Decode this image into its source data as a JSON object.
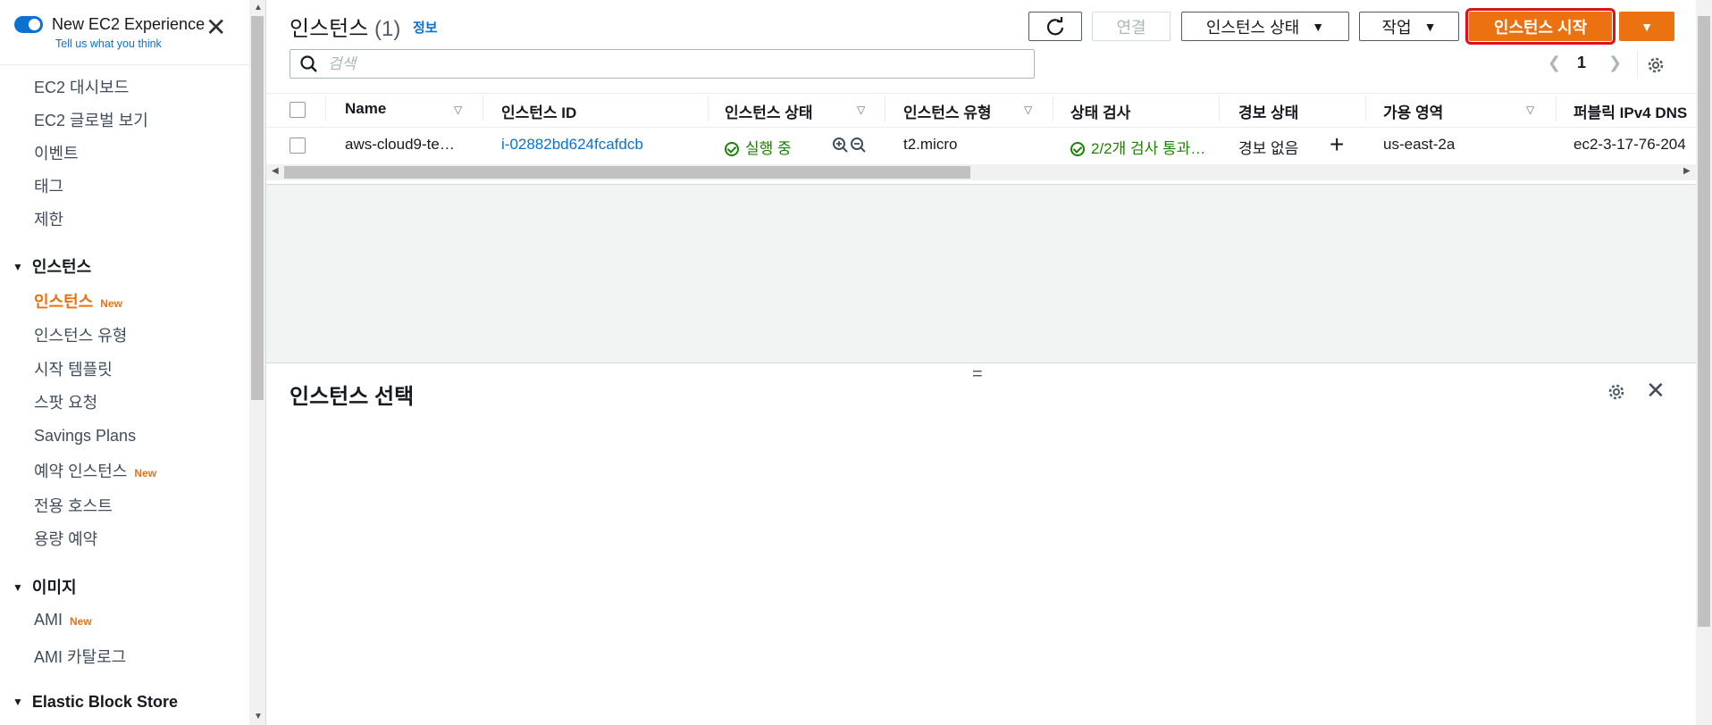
{
  "experience": {
    "title": "New EC2 Experience",
    "subtitle": "Tell us what you think"
  },
  "sidebar": {
    "top_items": [
      {
        "label": "EC2 대시보드"
      },
      {
        "label": "EC2 글로벌 보기"
      },
      {
        "label": "이벤트"
      },
      {
        "label": "태그"
      },
      {
        "label": "제한"
      }
    ],
    "sections": [
      {
        "title": "인스턴스",
        "items": [
          {
            "label": "인스턴스",
            "badge": "New",
            "active": true
          },
          {
            "label": "인스턴스 유형"
          },
          {
            "label": "시작 템플릿"
          },
          {
            "label": "스팟 요청"
          },
          {
            "label": "Savings Plans"
          },
          {
            "label": "예약 인스턴스",
            "badge": "New"
          },
          {
            "label": "전용 호스트"
          },
          {
            "label": "용량 예약"
          }
        ]
      },
      {
        "title": "이미지",
        "items": [
          {
            "label": "AMI",
            "badge": "New"
          },
          {
            "label": "AMI 카탈로그"
          }
        ]
      },
      {
        "title": "Elastic Block Store",
        "items": []
      }
    ]
  },
  "header": {
    "title": "인스턴스",
    "count": "(1)",
    "info": "정보"
  },
  "toolbar": {
    "connect": "연결",
    "instance_state": "인스턴스 상태",
    "actions": "작업",
    "launch": "인스턴스 시작"
  },
  "search": {
    "placeholder": "검색",
    "value": ""
  },
  "pagination": {
    "page": "1"
  },
  "table": {
    "headers": [
      "Name",
      "인스턴스 ID",
      "인스턴스 상태",
      "인스턴스 유형",
      "상태 검사",
      "경보 상태",
      "가용 영역",
      "퍼블릭 IPv4 DNS"
    ],
    "rows": [
      {
        "name": "aws-cloud9-te…",
        "instance_id": "i-02882bd624fcafdcb",
        "state": "실행 중",
        "type": "t2.micro",
        "status_check": "2/2개 검사 통과…",
        "alarm": "경보 없음",
        "az": "us-east-2a",
        "dns": "ec2-3-17-76-204"
      }
    ]
  },
  "detail": {
    "title": "인스턴스 선택"
  },
  "colors": {
    "accent": "#ec7211",
    "link": "#0972d3",
    "success": "#1d8102",
    "highlight": "#e0101c"
  }
}
